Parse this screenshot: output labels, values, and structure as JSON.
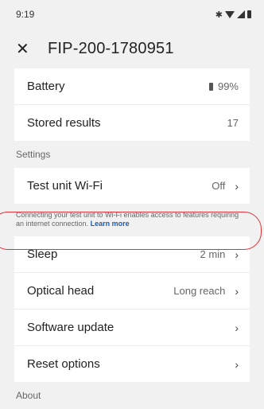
{
  "status": {
    "time": "9:19"
  },
  "header": {
    "title": "FIP-200-1780951"
  },
  "info": [
    {
      "label": "Battery",
      "value": "99%"
    },
    {
      "label": "Stored results",
      "value": "17"
    }
  ],
  "sections": {
    "settings": "Settings",
    "about": "About"
  },
  "settings_wifi": {
    "label": "Test unit Wi-Fi",
    "value": "Off"
  },
  "helper": {
    "text": "Connecting your test unit to Wi-Fi enables access to features requiring an internet connection.",
    "link": "Learn more"
  },
  "settings_items": [
    {
      "label": "Sleep",
      "value": "2 min"
    },
    {
      "label": "Optical head",
      "value": "Long reach"
    },
    {
      "label": "Software update",
      "value": ""
    },
    {
      "label": "Reset options",
      "value": ""
    }
  ],
  "icons": {
    "chevron": "›"
  }
}
